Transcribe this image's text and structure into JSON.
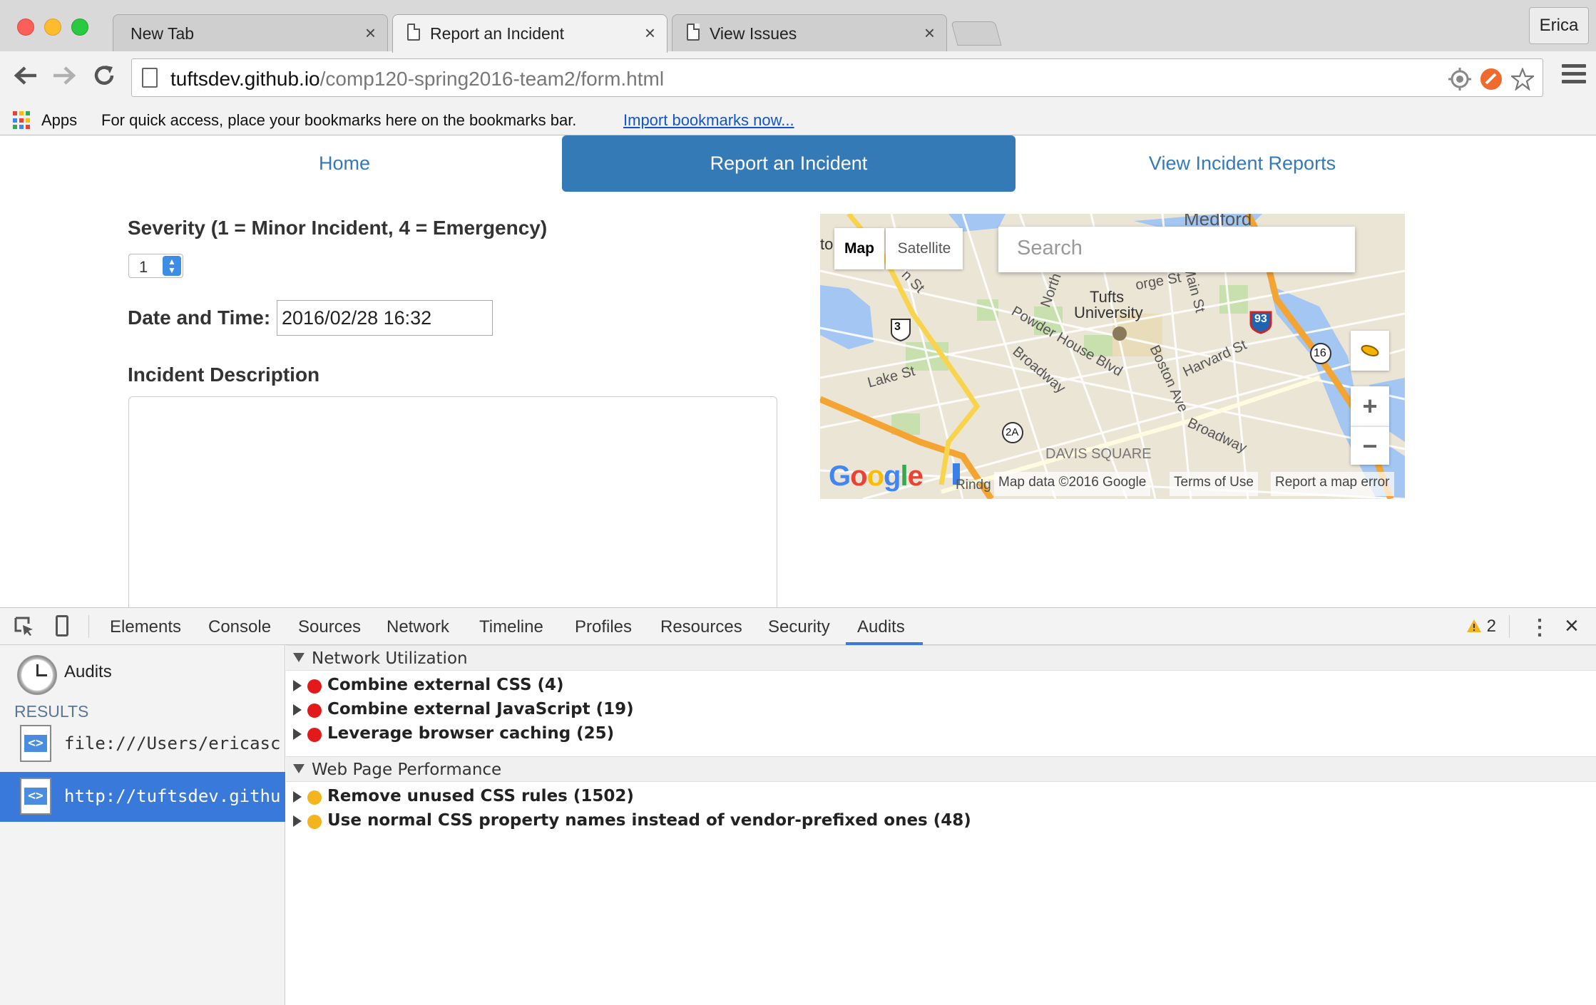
{
  "browser": {
    "tabs": [
      {
        "title": "New Tab"
      },
      {
        "title": "Report an Incident"
      },
      {
        "title": "View Issues"
      }
    ],
    "profile": "Erica",
    "url_host": "tuftsdev.github.io",
    "url_path": "/comp120-spring2016-team2/form.html",
    "bookmarks": {
      "apps_label": "Apps",
      "hint": "For quick access, place your bookmarks here on the bookmarks bar.",
      "import_link": "Import bookmarks now..."
    }
  },
  "page": {
    "nav": [
      {
        "label": "Home",
        "active": false
      },
      {
        "label": "Report an Incident",
        "active": true
      },
      {
        "label": "View Incident Reports",
        "active": false
      }
    ],
    "severity_label": "Severity (1 = Minor Incident, 4 = Emergency)",
    "severity_value": "1",
    "datetime_label": "Date and Time:",
    "datetime_value": "2016/02/28 16:32",
    "description_label": "Incident Description",
    "map": {
      "type_map": "Map",
      "type_satellite": "Satellite",
      "search_placeholder": "Search",
      "zoom_in": "+",
      "zoom_out": "−",
      "labels": {
        "medford": "Medford",
        "tufts": "Tufts",
        "university": "University",
        "lake_st": "Lake St",
        "powder_house": "Powder House Blvd",
        "broadway1": "Broadway",
        "broadway2": "Broadway",
        "boston_ave": "Boston Ave",
        "harvard_st": "Harvard St",
        "davis_square": "DAVIS SQUARE",
        "main_st": "Main St",
        "george_st": "orge St",
        "n_st": "n St",
        "north": "North",
        "to": "to",
        "r3": "3",
        "r2a": "2A",
        "r93": "93",
        "r16": "16",
        "rindge": "Rindg"
      },
      "google_logo": "Google",
      "map_data": "Map data ©2016 Google",
      "terms": "Terms of Use",
      "report_error": "Report a map error"
    }
  },
  "devtools": {
    "tabs": [
      "Elements",
      "Console",
      "Sources",
      "Network",
      "Timeline",
      "Profiles",
      "Resources",
      "Security",
      "Audits"
    ],
    "active_tab": "Audits",
    "warning_count": "2",
    "sidebar": {
      "audits": "Audits",
      "results_header": "RESULTS",
      "items": [
        {
          "label": "file:///Users/ericaschwartz",
          "selected": false
        },
        {
          "label": "http://tuftsdev.github.io/",
          "selected": true
        }
      ]
    },
    "categories": [
      {
        "title": "Network Utilization",
        "rules": [
          {
            "label": "Combine external CSS (4)",
            "severity": "red"
          },
          {
            "label": "Combine external JavaScript (19)",
            "severity": "red"
          },
          {
            "label": "Leverage browser caching (25)",
            "severity": "red"
          }
        ]
      },
      {
        "title": "Web Page Performance",
        "rules": [
          {
            "label": "Remove unused CSS rules (1502)",
            "severity": "yellow"
          },
          {
            "label": "Use normal CSS property names instead of vendor-prefixed ones (48)",
            "severity": "yellow"
          }
        ]
      }
    ]
  },
  "colors": {
    "accent": "#337ab7",
    "devtools_selection": "#3879d9",
    "error": "#e21a1a",
    "warning": "#f3b41d"
  }
}
